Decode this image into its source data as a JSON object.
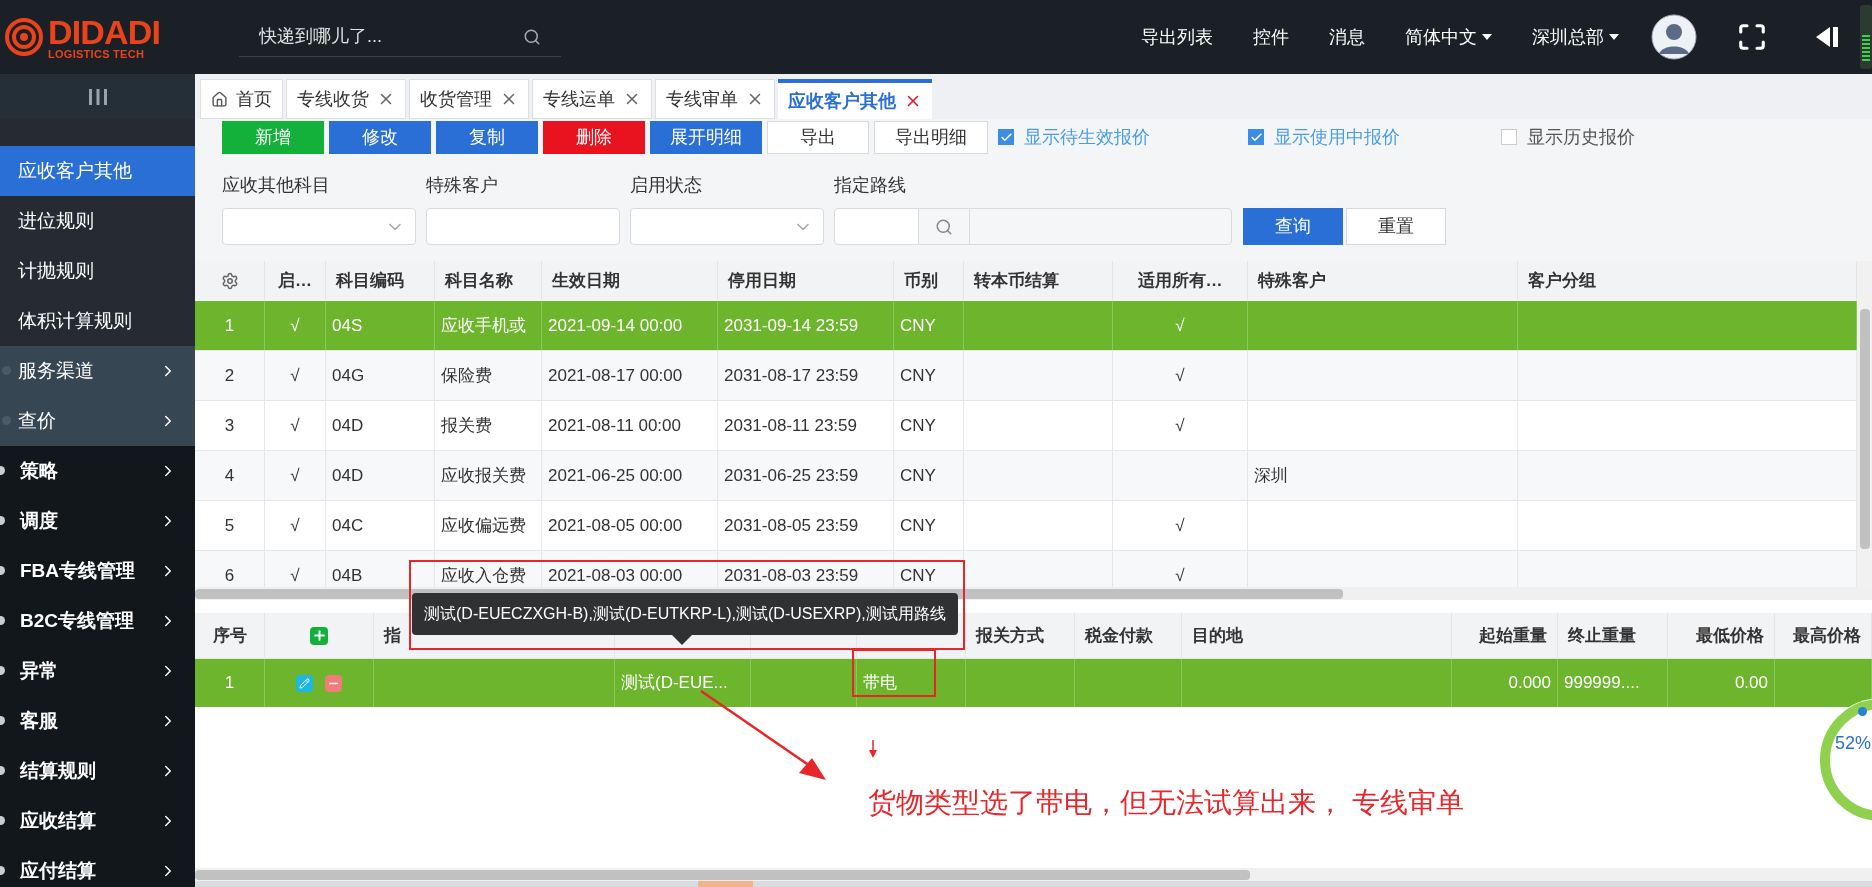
{
  "header": {
    "logo": {
      "name": "DIDADI",
      "tagline": "LOGISTICS TECH"
    },
    "search": {
      "placeholder": "快递到哪儿了..."
    },
    "menu": [
      {
        "label": "导出列表",
        "dropdown": false
      },
      {
        "label": "控件",
        "dropdown": false
      },
      {
        "label": "消息",
        "dropdown": false
      },
      {
        "label": "简体中文",
        "dropdown": true
      },
      {
        "label": "深圳总部",
        "dropdown": true
      }
    ]
  },
  "sidebar": {
    "items": [
      {
        "label": "应收客户其他",
        "kind": "sub",
        "selected": true
      },
      {
        "label": "进位规则",
        "kind": "sub",
        "selected": false
      },
      {
        "label": "计抛规则",
        "kind": "sub",
        "selected": false
      },
      {
        "label": "体积计算规则",
        "kind": "sub",
        "selected": false
      },
      {
        "label": "服务渠道",
        "kind": "group",
        "selected": false
      },
      {
        "label": "查价",
        "kind": "group",
        "selected": false
      },
      {
        "label": "策略",
        "kind": "top",
        "selected": false
      },
      {
        "label": "调度",
        "kind": "top",
        "selected": false
      },
      {
        "label": "FBA专线管理",
        "kind": "top",
        "selected": false
      },
      {
        "label": "B2C专线管理",
        "kind": "top",
        "selected": false
      },
      {
        "label": "异常",
        "kind": "top",
        "selected": false
      },
      {
        "label": "客服",
        "kind": "top",
        "selected": false
      },
      {
        "label": "结算规则",
        "kind": "top",
        "selected": false
      },
      {
        "label": "应收结算",
        "kind": "top",
        "selected": false
      },
      {
        "label": "应付结算",
        "kind": "top",
        "selected": false
      }
    ]
  },
  "tabs": [
    {
      "label": "首页",
      "kind": "home",
      "selected": false
    },
    {
      "label": "专线收货",
      "kind": "closable",
      "selected": false
    },
    {
      "label": "收货管理",
      "kind": "closable",
      "selected": false
    },
    {
      "label": "专线运单",
      "kind": "closable",
      "selected": false
    },
    {
      "label": "专线审单",
      "kind": "closable",
      "selected": false
    },
    {
      "label": "应收客户其他",
      "kind": "closable",
      "selected": true
    }
  ],
  "toolbar": {
    "buttons": [
      {
        "label": "新增",
        "kind": "success"
      },
      {
        "label": "修改",
        "kind": "primary"
      },
      {
        "label": "复制",
        "kind": "primary"
      },
      {
        "label": "删除",
        "kind": "danger"
      },
      {
        "label": "展开明细",
        "kind": "primary"
      },
      {
        "label": "导出",
        "kind": "default"
      },
      {
        "label": "导出明细",
        "kind": "default"
      }
    ],
    "checkboxes": [
      {
        "label": "显示待生效报价",
        "checked": true
      },
      {
        "label": "显示使用中报价",
        "checked": true
      },
      {
        "label": "显示历史报价",
        "checked": false
      }
    ]
  },
  "filters": {
    "fields": [
      {
        "label": "应收其他科目",
        "kind": "select"
      },
      {
        "label": "特殊客户",
        "kind": "input"
      },
      {
        "label": "启用状态",
        "kind": "select"
      },
      {
        "label": "指定路线",
        "kind": "route"
      }
    ],
    "buttons": [
      {
        "label": "查询",
        "kind": "primary"
      },
      {
        "label": "重置",
        "kind": "default"
      }
    ]
  },
  "main_table": {
    "columns": [
      {
        "kind": "settings"
      },
      {
        "label": "启…"
      },
      {
        "label": "科目编码"
      },
      {
        "label": "科目名称"
      },
      {
        "label": "生效日期"
      },
      {
        "label": "停用日期"
      },
      {
        "label": "币别"
      },
      {
        "label": "转本币结算"
      },
      {
        "label": "适用所有…"
      },
      {
        "label": "特殊客户"
      },
      {
        "label": "客户分组"
      }
    ],
    "rows": [
      {
        "selected": true,
        "cells": [
          "1",
          "√",
          "04S",
          "应收手机或",
          "2021-09-14 00:00",
          "2031-09-14 23:59",
          "CNY",
          null,
          "√",
          null,
          null
        ]
      },
      {
        "selected": false,
        "cells": [
          "2",
          "√",
          "04G",
          "保险费",
          "2021-08-17 00:00",
          "2031-08-17 23:59",
          "CNY",
          null,
          "√",
          null,
          null
        ]
      },
      {
        "selected": false,
        "cells": [
          "3",
          "√",
          "04D",
          "报关费",
          "2021-08-11 00:00",
          "2031-08-11 23:59",
          "CNY",
          null,
          "√",
          null,
          null
        ]
      },
      {
        "selected": false,
        "cells": [
          "4",
          "√",
          "04D",
          "应收报关费",
          "2021-06-25 00:00",
          "2031-06-25 23:59",
          "CNY",
          null,
          null,
          "深圳",
          null
        ]
      },
      {
        "selected": false,
        "cells": [
          "5",
          "√",
          "04C",
          "应收偏远费",
          "2021-08-05 00:00",
          "2031-08-05 23:59",
          "CNY",
          null,
          "√",
          null,
          null
        ]
      },
      {
        "selected": false,
        "cells": [
          "6",
          "√",
          "04B",
          "应收入仓费",
          "2021-08-03 00:00",
          "2031-08-03 23:59",
          "CNY",
          null,
          "√",
          null,
          null
        ]
      }
    ]
  },
  "detail_table": {
    "columns": [
      {
        "label": "序号"
      },
      {
        "kind": "add"
      },
      {
        "label": "指"
      },
      {
        "kind": "covered"
      },
      {
        "kind": "covered"
      },
      {
        "kind": "covered"
      },
      {
        "label": "报关方式"
      },
      {
        "label": "税金付款"
      },
      {
        "label": "目的地"
      },
      {
        "label": "起始重量"
      },
      {
        "label": "终止重量"
      },
      {
        "label": "最低价格"
      },
      {
        "label": "最高价格"
      }
    ],
    "rows": [
      {
        "selected": true,
        "cells": [
          "1",
          null,
          null,
          "测试(D-EUE...",
          null,
          "带电",
          null,
          null,
          null,
          "0.000",
          "999999....",
          "0.00",
          null
        ]
      }
    ]
  },
  "tooltip": {
    "text": "测试(D-EUECZXGH-B),测试(D-EUTKRP-L),测试(D-USEXRP),测试用路线"
  },
  "annotation": {
    "text": "货物类型选了带电，但无法试算出来， 专线审单"
  },
  "gauge": {
    "reading": "52%"
  }
}
